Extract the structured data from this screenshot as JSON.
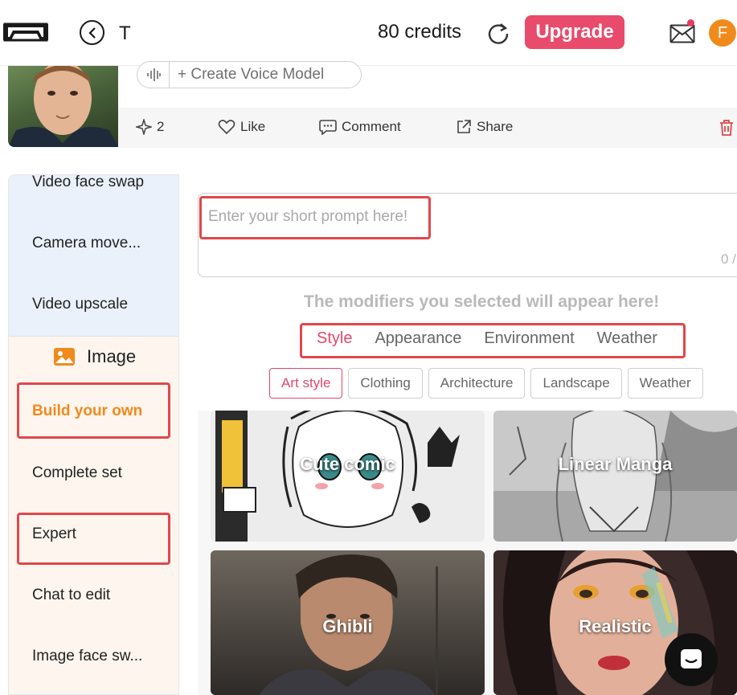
{
  "header": {
    "title": "T",
    "credits": "80 credits",
    "upgrade_label": "Upgrade",
    "avatar_initial": "F"
  },
  "profile": {
    "voice_button_label": "+ Create Voice Model",
    "actions": {
      "spark_count": "2",
      "like_label": "Like",
      "comment_label": "Comment",
      "share_label": "Share"
    }
  },
  "sidebar": {
    "video_items": [
      "Video face swap",
      "Camera move...",
      "Video upscale"
    ],
    "image_section_title": "Image",
    "image_items": [
      "Build your own",
      "Complete set",
      "Expert",
      "Chat to edit",
      "Image face sw..."
    ],
    "active_item": "Build your own"
  },
  "prompt": {
    "placeholder": "Enter your short prompt here!",
    "char_count": "0 /"
  },
  "modifiers_hint": "The modifiers you selected will appear here!",
  "tabs": [
    "Style",
    "Appearance",
    "Environment",
    "Weather"
  ],
  "active_tab": "Style",
  "chips": [
    "Art style",
    "Clothing",
    "Architecture",
    "Landscape",
    "Weather"
  ],
  "active_chip": "Art style",
  "styles": [
    "Cute comic",
    "Linear Manga",
    "Ghibli",
    "Realistic"
  ],
  "colors": {
    "accent": "#e0476b",
    "upgrade": "#e84b6c",
    "active_sidebar": "#f08a1c",
    "highlight_box": "#e0474b"
  }
}
